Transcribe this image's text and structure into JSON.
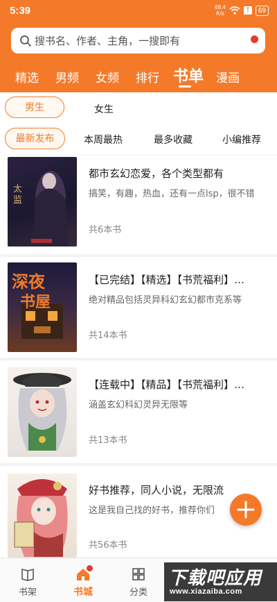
{
  "status": {
    "time": "5:39",
    "speed_top": "68.4",
    "speed_unit": "K/s",
    "battery": "69"
  },
  "search": {
    "placeholder": "搜书名、作者、主角，一搜即有"
  },
  "nav": {
    "items": [
      "精选",
      "男频",
      "女频",
      "排行",
      "书单",
      "漫画"
    ],
    "active": "书单"
  },
  "filters": {
    "gender": [
      "男生",
      "女生"
    ],
    "gender_selected": "男生",
    "sort": [
      "最新发布",
      "本周最热",
      "最多收藏",
      "小编推荐"
    ],
    "sort_selected": "最新发布"
  },
  "booklists": [
    {
      "title": "都市玄幻恋爱，各个类型都有",
      "desc": "搞笑，有趣，热血，还有一点lsp，很不错",
      "count": "共6本书",
      "cover_text": "太监能有什么坏心思"
    },
    {
      "title": "【已完结】【精选】【书荒福利】…",
      "desc": "绝对精品包括灵异科幻玄幻都市克系等",
      "count": "共14本书",
      "cover_text": "深夜书屋"
    },
    {
      "title": "【连载中】【精品】【书荒福利】…",
      "desc": "涵盖玄幻科幻灵异无限等",
      "count": "共13本书",
      "cover_text": ""
    },
    {
      "title": "好书推荐，同人小说，无限流",
      "desc": "这是我自己找的好书，推荐你们",
      "count": "共56本书",
      "cover_text": ""
    }
  ],
  "bottom_tabs": [
    {
      "label": "书架",
      "icon": "book-icon"
    },
    {
      "label": "书城",
      "icon": "home-icon"
    },
    {
      "label": "分类",
      "icon": "grid-icon"
    }
  ],
  "bottom_active": "书城",
  "watermark": {
    "main": "下载吧应用",
    "url": "www.xiazaiba.com"
  },
  "colors": {
    "accent": "#f47a2a",
    "badge": "#e53935"
  }
}
